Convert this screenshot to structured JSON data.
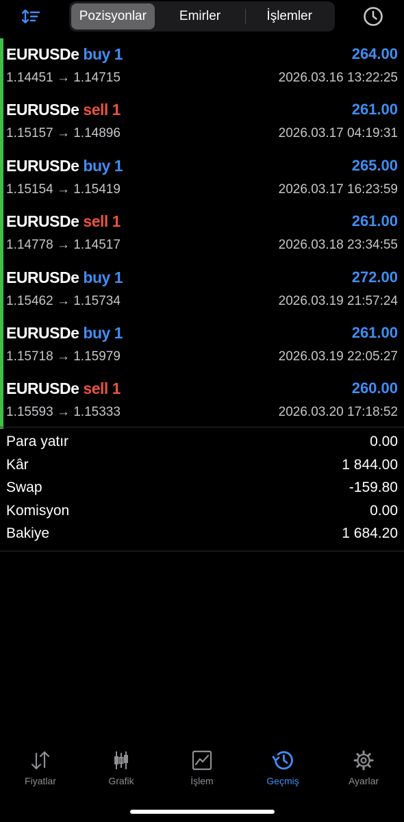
{
  "header": {
    "tabs": [
      {
        "label": "Pozisyonlar",
        "active": true
      },
      {
        "label": "Emirler",
        "active": false
      },
      {
        "label": "İşlemler",
        "active": false
      }
    ],
    "sort_icon": "sort-arrows-icon",
    "history_icon": "clock-icon"
  },
  "colors": {
    "buy": "#3f8ef5",
    "sell": "#e9533f",
    "profit": "#3f8ef5",
    "accent_bar": "#3fbf46",
    "active_tab": "#3f8ef5"
  },
  "trades": [
    {
      "symbol": "EURUSDe",
      "side": "buy",
      "volume": "buy 1",
      "prices": "1.14451 → 1.14715",
      "profit": "264.00",
      "time": "2026.03.16 13:22:25"
    },
    {
      "symbol": "EURUSDe",
      "side": "sell",
      "volume": "sell 1",
      "prices": "1.15157 → 1.14896",
      "profit": "261.00",
      "time": "2026.03.17 04:19:31"
    },
    {
      "symbol": "EURUSDe",
      "side": "buy",
      "volume": "buy 1",
      "prices": "1.15154 → 1.15419",
      "profit": "265.00",
      "time": "2026.03.17 16:23:59"
    },
    {
      "symbol": "EURUSDe",
      "side": "sell",
      "volume": "sell 1",
      "prices": "1.14778 → 1.14517",
      "profit": "261.00",
      "time": "2026.03.18 23:34:55"
    },
    {
      "symbol": "EURUSDe",
      "side": "buy",
      "volume": "buy 1",
      "prices": "1.15462 → 1.15734",
      "profit": "272.00",
      "time": "2026.03.19 21:57:24"
    },
    {
      "symbol": "EURUSDe",
      "side": "buy",
      "volume": "buy 1",
      "prices": "1.15718 → 1.15979",
      "profit": "261.00",
      "time": "2026.03.19 22:05:27"
    },
    {
      "symbol": "EURUSDe",
      "side": "sell",
      "volume": "sell 1",
      "prices": "1.15593 → 1.15333",
      "profit": "260.00",
      "time": "2026.03.20 17:18:52"
    }
  ],
  "summary": [
    {
      "label": "Para yatır",
      "value": "0.00"
    },
    {
      "label": "Kâr",
      "value": "1 844.00"
    },
    {
      "label": "Swap",
      "value": "-159.80"
    },
    {
      "label": "Komisyon",
      "value": "0.00"
    },
    {
      "label": "Bakiye",
      "value": "1 684.20"
    }
  ],
  "tabbar": [
    {
      "label": "Fiyatlar",
      "icon": "quotes-arrows-icon",
      "active": false
    },
    {
      "label": "Grafik",
      "icon": "candlestick-chart-icon",
      "active": false
    },
    {
      "label": "İşlem",
      "icon": "trade-chart-icon",
      "active": false
    },
    {
      "label": "Geçmiş",
      "icon": "history-icon",
      "active": true
    },
    {
      "label": "Ayarlar",
      "icon": "gear-icon",
      "active": false
    }
  ]
}
